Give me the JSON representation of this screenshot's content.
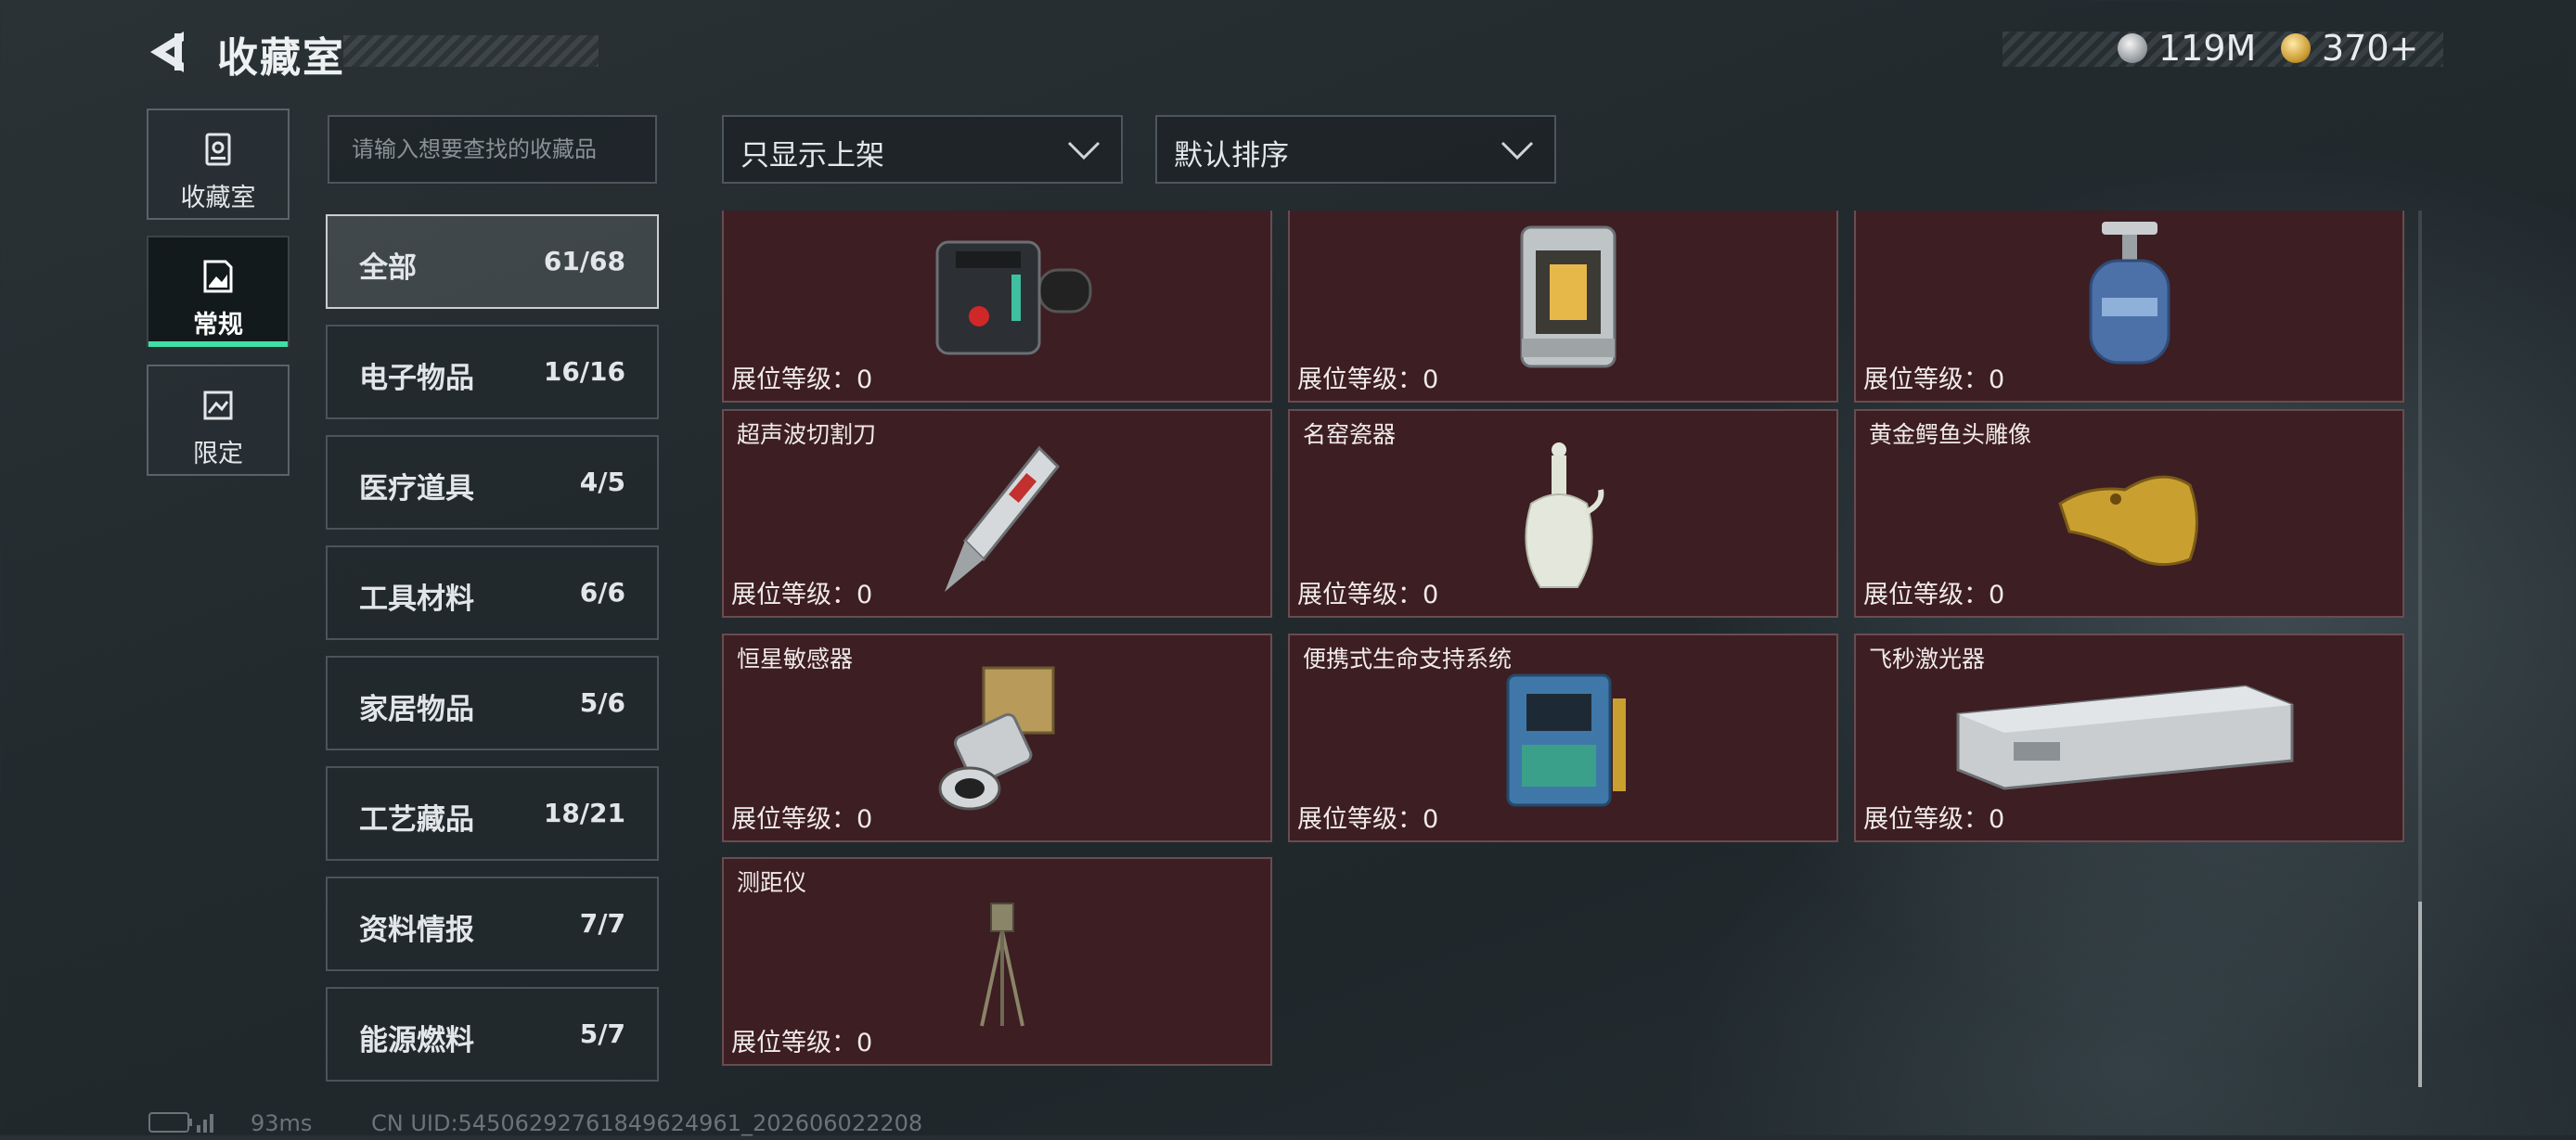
{
  "header": {
    "title": "收藏室",
    "currency_silver": "119M",
    "currency_gold": "370+"
  },
  "rail": [
    {
      "label": "收藏室",
      "icon": "vault-icon"
    },
    {
      "label": "常规",
      "icon": "document-icon"
    },
    {
      "label": "限定",
      "icon": "image-icon"
    }
  ],
  "search": {
    "placeholder": "请输入想要查找的收藏品"
  },
  "filters": {
    "listing": "只显示上架",
    "sort": "默认排序"
  },
  "categories": [
    {
      "name": "全部",
      "count": "61/68"
    },
    {
      "name": "电子物品",
      "count": "16/16"
    },
    {
      "name": "医疗道具",
      "count": "4/5"
    },
    {
      "name": "工具材料",
      "count": "6/6"
    },
    {
      "name": "家居物品",
      "count": "5/6"
    },
    {
      "name": "工艺藏品",
      "count": "18/21"
    },
    {
      "name": "资料情报",
      "count": "7/7"
    },
    {
      "name": "能源燃料",
      "count": "5/7"
    }
  ],
  "level_label": "展位等级：0",
  "items": [
    {
      "name": "",
      "icon": "electronic-device-icon"
    },
    {
      "name": "",
      "icon": "reactor-core-icon"
    },
    {
      "name": "",
      "icon": "gas-canister-icon"
    },
    {
      "name": "超声波切割刀",
      "icon": "ultrasonic-knife-icon"
    },
    {
      "name": "名窑瓷器",
      "icon": "porcelain-vase-icon"
    },
    {
      "name": "黄金鳄鱼头雕像",
      "icon": "gold-crocodile-icon"
    },
    {
      "name": "恒星敏感器",
      "icon": "star-sensor-icon"
    },
    {
      "name": "便携式生命支持系统",
      "icon": "life-support-icon"
    },
    {
      "name": "飞秒激光器",
      "icon": "femtosecond-laser-icon"
    },
    {
      "name": "测距仪",
      "icon": "rangefinder-icon"
    }
  ],
  "status": {
    "ping": "93ms",
    "uid": "CN UID:545062927618496249​61_202606022208"
  },
  "colors": {
    "accent": "#3fe0a8",
    "card_bg": "#3d1e23",
    "card_border": "#6a4c50"
  }
}
